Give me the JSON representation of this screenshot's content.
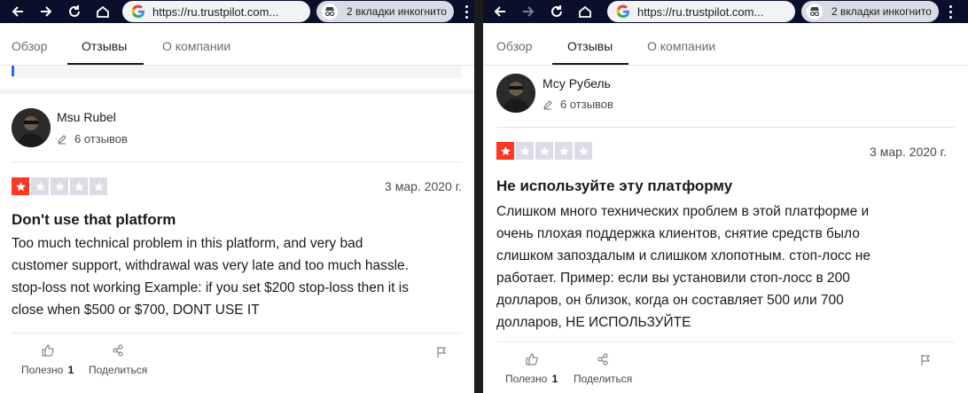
{
  "browser": {
    "url": "https://ru.trustpilot.com...",
    "incognito_label": "2 вкладки инкогнито"
  },
  "icons": {
    "back": "arrow-left-icon",
    "forward": "arrow-right-icon",
    "reload": "reload-icon",
    "home": "home-icon",
    "site": "google-icon",
    "incognito": "incognito-icon",
    "menu": "kebab-menu-icon",
    "reviews_count": "pencil-icon",
    "like": "thumbs-up-icon",
    "share": "share-icon",
    "report": "flag-icon"
  },
  "tabs": [
    "Обзор",
    "Отзывы",
    "О компании"
  ],
  "left": {
    "reviewer": "Msu Rubel",
    "review_count": "6 отзывов",
    "rating": 1,
    "date": "3 мар. 2020 г.",
    "title": "Don't use that platform",
    "body_lines": [
      "Too much technical problem in this platform, and very bad",
      "customer support, withdrawal was very late and too much hassle.",
      "stop-loss not working Example: if you set $200 stop-loss then it is",
      "close when $500 or $700, DONT USE IT"
    ],
    "helpful_label": "Полезно",
    "helpful_count": "1",
    "share_label": "Поделиться"
  },
  "right": {
    "reviewer": "Мсу Рубель",
    "review_count": "6 отзывов",
    "rating": 1,
    "date": "3 мар. 2020 г.",
    "title": "Не используйте эту платформу",
    "body_lines": [
      "Слишком много технических проблем в этой платформе и",
      "очень плохая поддержка клиентов, снятие средств было",
      "слишком запоздалым и слишком хлопотным. стоп-лосс не",
      "работает. Пример: если вы установили стоп-лосс в 200",
      "долларов, он близок, когда он составляет 500 или 700",
      "долларов, НЕ ИСПОЛЬЗУЙТЕ"
    ],
    "helpful_label": "Полезно",
    "helpful_count": "1",
    "share_label": "Поделиться"
  },
  "colors": {
    "chrome_bg": "#0a0f2b",
    "star_on": "#ff3722",
    "star_off": "#dcdce6",
    "accent_blue": "#1c6cfd"
  }
}
